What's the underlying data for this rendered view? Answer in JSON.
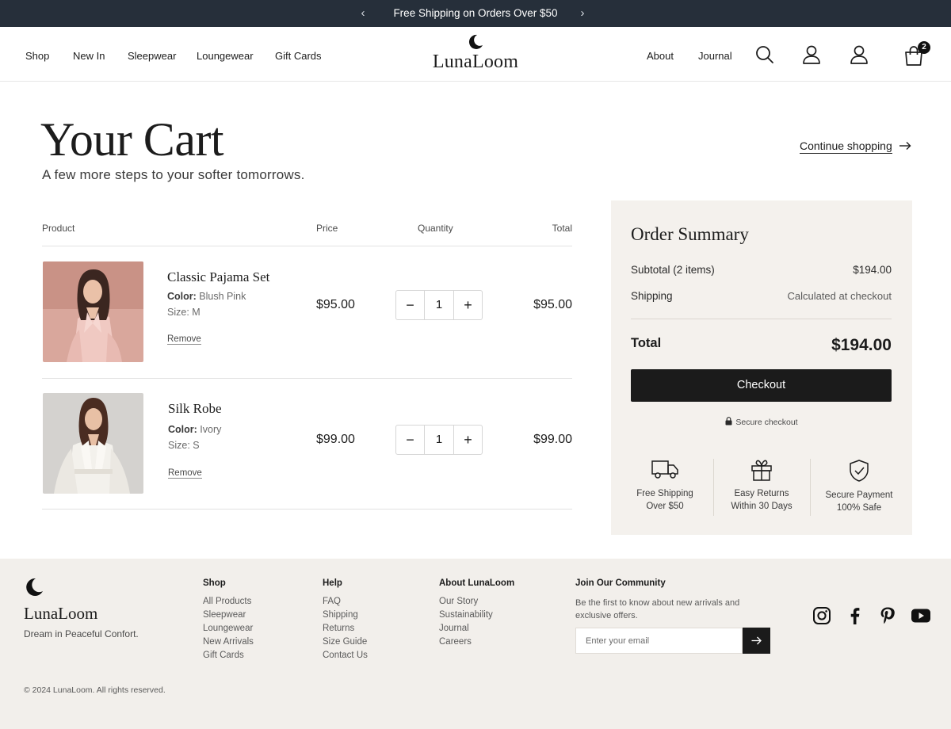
{
  "announcement": {
    "text": "Free Shipping on Orders Over $50",
    "prev_icon": "chevron-left-icon",
    "next_icon": "chevron-right-icon"
  },
  "header": {
    "nav_left": [
      "Shop",
      "New In",
      "Sleepwear",
      "Loungewear",
      "Gift Cards"
    ],
    "brand": "LunaLoom",
    "nav_right": [
      "About",
      "Journal"
    ],
    "icons": [
      "search-icon",
      "account-icon",
      "user-icon",
      "cart-icon"
    ],
    "cart_count": "2"
  },
  "page": {
    "title": "Your Cart",
    "subtitle": "A few more steps to your softer tomorrows.",
    "continue_label": "Continue shopping"
  },
  "cart": {
    "columns": [
      "Product",
      "Price",
      "Quantity",
      "Total"
    ],
    "items": [
      {
        "name": "Classic Pajama Set",
        "color_label": "Color:",
        "color": "Blush Pink",
        "size_label": "Size:",
        "size": "M",
        "price": "$95.00",
        "quantity": "1",
        "total": "$95.00",
        "remove_label": "Remove"
      },
      {
        "name": "Silk Robe",
        "color_label": "Color:",
        "color": "Ivory",
        "size_label": "Size:",
        "size": "S",
        "price": "$99.00",
        "quantity": "1",
        "total": "$99.00",
        "remove_label": "Remove"
      }
    ]
  },
  "summary": {
    "title": "Order Summary",
    "subtotal_label": "Subtotal (2 items)",
    "subtotal_value": "$194.00",
    "shipping_label": "Shipping",
    "shipping_value": "Calculated at checkout",
    "total_label": "Total",
    "total_value": "$194.00",
    "checkout_label": "Checkout",
    "secure_label": "Secure checkout",
    "features": [
      {
        "icon": "truck-icon",
        "line1": "Free Shipping",
        "line2": "Over $50"
      },
      {
        "icon": "gift-icon",
        "line1": "Easy Returns",
        "line2": "Within 30 Days"
      },
      {
        "icon": "shield-check-icon",
        "line1": "Secure Payment",
        "line2": "100% Safe"
      }
    ]
  },
  "footer": {
    "brand": "LunaLoom",
    "tagline": "Dream in Peaceful Confort.",
    "columns": [
      {
        "heading": "Shop",
        "links": [
          "All Products",
          "Sleepwear",
          "Loungewear",
          "New Arrivals",
          "Gift Cards"
        ]
      },
      {
        "heading": "Help",
        "links": [
          "FAQ",
          "Shipping",
          "Returns",
          "Size Guide",
          "Contact Us"
        ]
      },
      {
        "heading": "About LunaLoom",
        "links": [
          "Our Story",
          "Sustainability",
          "Journal",
          "Careers"
        ]
      }
    ],
    "join_heading": "Join Our Community",
    "join_text": "Be the first to know about new arrivals and exclusive offers.",
    "email_placeholder": "Enter your email",
    "social": [
      "instagram-icon",
      "facebook-icon",
      "pinterest-icon",
      "youtube-icon"
    ],
    "copyright": "© 2024 LunaLoom. All rights reserved."
  },
  "colors": {
    "announcement_bg": "#262f3a",
    "summary_bg": "#f4f1ed",
    "footer_bg": "#f2efeb",
    "button": "#1b1b1b"
  }
}
